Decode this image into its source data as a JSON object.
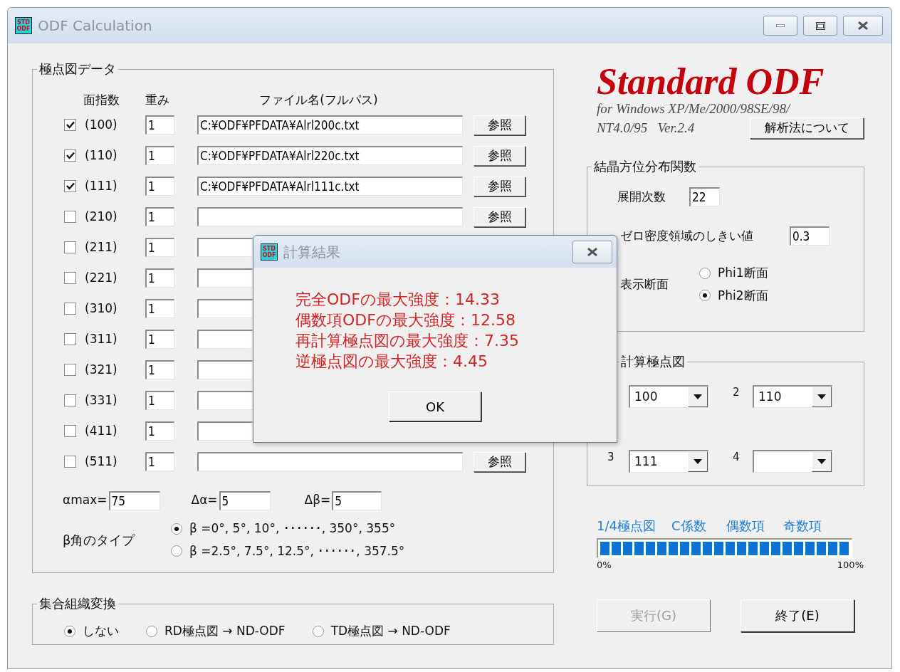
{
  "window": {
    "title": "ODF Calculation",
    "icon_text": [
      "STD",
      "ODF"
    ]
  },
  "pole_figure_data": {
    "title": "極点図データ",
    "columns": [
      "面指数",
      "重み",
      "ファイル名(フルパス)"
    ],
    "rows": [
      {
        "checked": true,
        "plane": "(100)",
        "weight": "1",
        "file": "C:¥ODF¥PFDATA¥Alrl200c.txt",
        "browse": "参照"
      },
      {
        "checked": true,
        "plane": "(110)",
        "weight": "1",
        "file": "C:¥ODF¥PFDATA¥Alrl220c.txt",
        "browse": "参照"
      },
      {
        "checked": true,
        "plane": "(111)",
        "weight": "1",
        "file": "C:¥ODF¥PFDATA¥Alrl111c.txt",
        "browse": "参照"
      },
      {
        "checked": false,
        "plane": "(210)",
        "weight": "1",
        "browse": "参照"
      },
      {
        "checked": false,
        "plane": "(211)",
        "weight": "1"
      },
      {
        "checked": false,
        "plane": "(221)",
        "weight": "1"
      },
      {
        "checked": false,
        "plane": "(310)",
        "weight": "1"
      },
      {
        "checked": false,
        "plane": "(311)",
        "weight": "1"
      },
      {
        "checked": false,
        "plane": "(321)",
        "weight": "1"
      },
      {
        "checked": false,
        "plane": "(331)",
        "weight": "1"
      },
      {
        "checked": false,
        "plane": "(411)",
        "weight": "1"
      },
      {
        "checked": false,
        "plane": "(511)",
        "weight": "1",
        "browse": "参照"
      }
    ],
    "params": [
      {
        "label": "αmax=",
        "value": "75"
      },
      {
        "label": "Δα=",
        "value": "5"
      },
      {
        "label": "Δβ=",
        "value": "5"
      }
    ],
    "beta_type": {
      "label": "β角のタイプ",
      "options": [
        {
          "label": "β =0°, 5°, 10°, ･･････, 350°, 355°",
          "selected": true
        },
        {
          "label": "β =2.5°, 7.5°, 12.5°, ･･････, 357.5°",
          "selected": false
        }
      ]
    }
  },
  "texture_transform": {
    "title": "集合組織変換",
    "options": [
      {
        "label": "しない",
        "selected": true
      },
      {
        "label": "RD極点図 → ND-ODF",
        "selected": false
      },
      {
        "label": "TD極点図 → ND-ODF",
        "selected": false
      }
    ]
  },
  "logo": {
    "title": "Standard ODF",
    "subtitle_lines": [
      "for Windows XP/Me/2000/98SE/98/",
      "NT4.0/95   Ver.2.4"
    ],
    "about_button": "解析法について"
  },
  "odf": {
    "title": "結晶方位分布関数",
    "expansion_order": {
      "label": "展開次数",
      "value": "22"
    },
    "zero_threshold": {
      "label": "ゼロ密度領域のしきい値",
      "value": "0.3"
    },
    "section": {
      "label": "表示断面",
      "options": [
        {
          "label": "Phi1断面",
          "selected": false
        },
        {
          "label": "Phi2断面",
          "selected": true
        }
      ]
    }
  },
  "recalc": {
    "title": "計算極点図",
    "combos": [
      {
        "value": "100"
      },
      {
        "label": "2",
        "value": "110"
      },
      {
        "label": "3",
        "value": "111"
      },
      {
        "label": "4"
      }
    ]
  },
  "progress": {
    "steps": [
      "1/4極点図",
      "C係数",
      "偶数項",
      "奇数項"
    ],
    "level": 1,
    "min_label": "0%",
    "max_label": "100%"
  },
  "buttons": [
    {
      "label": "実行(G)",
      "disabled": true
    },
    {
      "label": "終了(E)",
      "disabled": false
    }
  ],
  "dialog": {
    "title": "計算結果",
    "icon_text": [
      "STD",
      "ODF"
    ],
    "lines": [
      "完全ODFの最大強度：14.33",
      "偶数項ODFの最大強度：12.58",
      "再計算極点図の最大強度：7.35",
      "逆極点図の最大強度：4.45"
    ],
    "ok": "OK"
  }
}
